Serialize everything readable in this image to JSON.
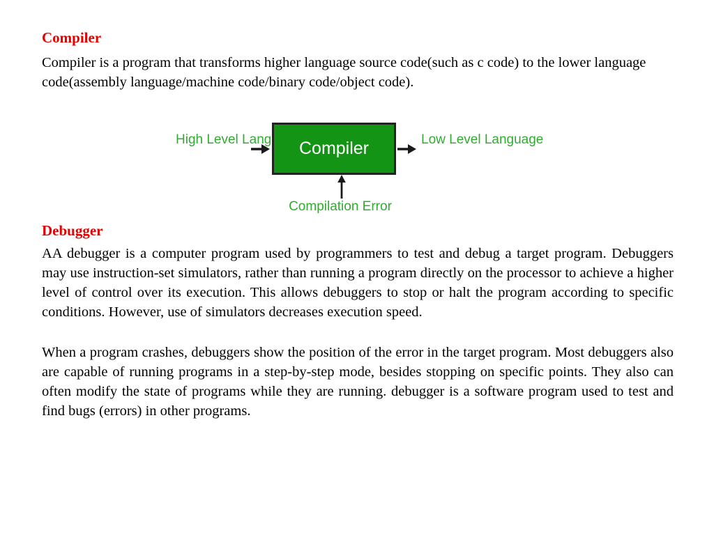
{
  "slide": {
    "sections": [
      {
        "heading": "Compiler",
        "paragraphs": [
          "Compiler is a program that transforms higher language source code(such as c code) to the lower language code(assembly language/machine code/binary code/object code)."
        ]
      },
      {
        "heading": "Debugger",
        "paragraphs": [
          "AA debugger is a computer program used by programmers to test and debug a target program. Debuggers may use instruction-set simulators, rather than running a program directly on the processor to achieve a higher level of control over its execution. This allows debuggers to stop or halt the program according to specific conditions. However, use of simulators decreases execution speed.",
          "When a program crashes, debuggers show the position of the error in the target program. Most debuggers also are capable of running programs in a step-by-step mode, besides stopping on specific points. They also can often modify the state of programs while they are running. debugger is a software program  used to test and find bugs (errors) in other programs."
        ]
      }
    ]
  },
  "diagram": {
    "input_label": "High Level Language",
    "box_label": "Compiler",
    "output_label": "Low Level Language",
    "error_label": "Compilation Error",
    "colors": {
      "box_fill": "#149414",
      "box_border": "#232323",
      "box_text": "#ffffff",
      "label_text": "#32ab32",
      "arrow": "#1a1a1a"
    }
  },
  "theme": {
    "heading_color": "#e60000",
    "body_color": "#000000",
    "background": "#ffffff"
  }
}
